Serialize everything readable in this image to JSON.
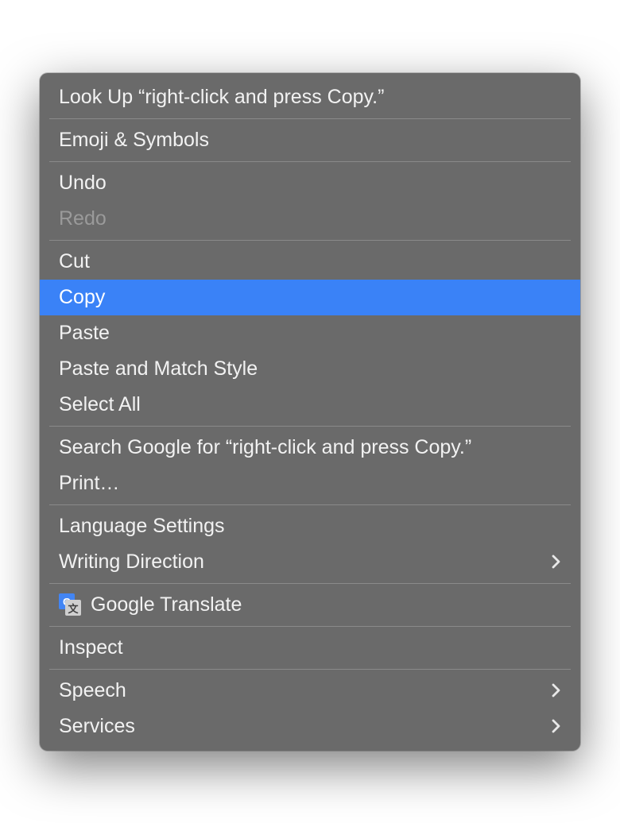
{
  "menu": {
    "groups": [
      [
        {
          "id": "lookup",
          "label": "Look Up “right-click and press Copy.”",
          "disabled": false,
          "submenu": false,
          "highlighted": false,
          "icon": null
        }
      ],
      [
        {
          "id": "emoji-symbols",
          "label": "Emoji & Symbols",
          "disabled": false,
          "submenu": false,
          "highlighted": false,
          "icon": null
        }
      ],
      [
        {
          "id": "undo",
          "label": "Undo",
          "disabled": false,
          "submenu": false,
          "highlighted": false,
          "icon": null
        },
        {
          "id": "redo",
          "label": "Redo",
          "disabled": true,
          "submenu": false,
          "highlighted": false,
          "icon": null
        }
      ],
      [
        {
          "id": "cut",
          "label": "Cut",
          "disabled": false,
          "submenu": false,
          "highlighted": false,
          "icon": null
        },
        {
          "id": "copy",
          "label": "Copy",
          "disabled": false,
          "submenu": false,
          "highlighted": true,
          "icon": null
        },
        {
          "id": "paste",
          "label": "Paste",
          "disabled": false,
          "submenu": false,
          "highlighted": false,
          "icon": null
        },
        {
          "id": "paste-match-style",
          "label": "Paste and Match Style",
          "disabled": false,
          "submenu": false,
          "highlighted": false,
          "icon": null
        },
        {
          "id": "select-all",
          "label": "Select All",
          "disabled": false,
          "submenu": false,
          "highlighted": false,
          "icon": null
        }
      ],
      [
        {
          "id": "search-google",
          "label": "Search Google for “right-click and press Copy.”",
          "disabled": false,
          "submenu": false,
          "highlighted": false,
          "icon": null
        },
        {
          "id": "print",
          "label": "Print…",
          "disabled": false,
          "submenu": false,
          "highlighted": false,
          "icon": null
        }
      ],
      [
        {
          "id": "language-settings",
          "label": "Language Settings",
          "disabled": false,
          "submenu": false,
          "highlighted": false,
          "icon": null
        },
        {
          "id": "writing-direction",
          "label": "Writing Direction",
          "disabled": false,
          "submenu": true,
          "highlighted": false,
          "icon": null
        }
      ],
      [
        {
          "id": "google-translate",
          "label": "Google Translate",
          "disabled": false,
          "submenu": false,
          "highlighted": false,
          "icon": "google-translate"
        }
      ],
      [
        {
          "id": "inspect",
          "label": "Inspect",
          "disabled": false,
          "submenu": false,
          "highlighted": false,
          "icon": null
        }
      ],
      [
        {
          "id": "speech",
          "label": "Speech",
          "disabled": false,
          "submenu": true,
          "highlighted": false,
          "icon": null
        },
        {
          "id": "services",
          "label": "Services",
          "disabled": false,
          "submenu": true,
          "highlighted": false,
          "icon": null
        }
      ]
    ]
  },
  "colors": {
    "menu_bg": "#6a6a6a",
    "highlight": "#3a82f7",
    "text": "#f2f2f2",
    "disabled_text": "#9a9a9a",
    "separator": "#8a8a8a"
  }
}
